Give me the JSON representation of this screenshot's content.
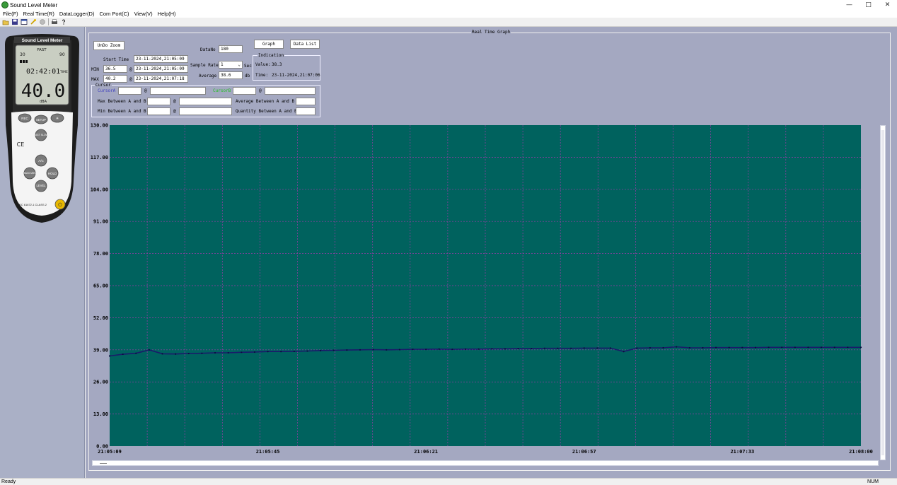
{
  "window": {
    "title": "Sound Level Meter",
    "minimize": "—",
    "maximize": "□",
    "close": "✕"
  },
  "menu": [
    "File(F)",
    "Real Time(R)",
    "DataLogger(D)",
    "Com Port(C)",
    "View(V)",
    "Help(H)"
  ],
  "toolbar": {
    "icons": [
      "open-icon",
      "save-icon",
      "window-icon",
      "connect-icon",
      "disconnect-icon",
      "print-icon",
      "help-icon"
    ]
  },
  "device": {
    "brand_label": "Sound Level Meter",
    "lcd_mode": "FAST",
    "lcd_range_low": "30",
    "lcd_range_high": "90",
    "lcd_time": "02:42:01",
    "lcd_time_label": "TIME",
    "lcd_value": "40.0",
    "lcd_unit": "dBA",
    "btn_rec": "REC",
    "btn_setup": "SETUP",
    "btn_light": "☀",
    "btn_fast_slow": "FAST SLOW",
    "btn_ac": "A/C",
    "btn_maxmin": "MAX MIN",
    "btn_hold": "HOLD",
    "btn_level": "LEVEL",
    "ce_mark": "CE",
    "standard": "IEC 61672-1 CLASS 2",
    "power": "⏻"
  },
  "controls": {
    "frame_title": "Real Time Graph",
    "undo_zoom": "UnDo Zoom",
    "start_time_label": "Start Time",
    "start_time": "23-11-2024,21:05:09",
    "min_label": "MIN",
    "min_value": "36.5",
    "min_at": "@",
    "min_time": "23-11-2024,21:05:09",
    "max_label": "MAX",
    "max_value": "40.2",
    "max_at": "@",
    "max_time": "23-11-2024,21:07:18",
    "datano_label": "DataNo",
    "datano_value": "180",
    "sample_rate_label": "Sample Rate",
    "sample_rate_value": "1",
    "sample_rate_unit": "Sec",
    "average_label": "Average",
    "average_value": "38.6",
    "average_unit": "db",
    "graph_btn": "Graph",
    "data_list_btn": "Data List",
    "indication_title": "Indication",
    "indication_value_label": "Value:",
    "indication_value": "38.3",
    "indication_time_label": "Time:",
    "indication_time": "23-11-2024,21:07:06"
  },
  "cursor": {
    "title": "Cursor",
    "cursor_a_label": "CursorA",
    "cursor_b_label": "CursorB",
    "at": "@",
    "max_between": "Max Between A and B",
    "min_between": "Min Between A and B",
    "avg_between": "Average Between A and B",
    "qty_between": "Quantity Between A and B",
    "cursor_a_color": "#4040c0",
    "cursor_b_color": "#20c020"
  },
  "status": {
    "left": "Ready",
    "right": "NUM"
  },
  "colors": {
    "plot_bg": "#00625e",
    "grid": "#9a3aa8",
    "line": "#1a1a6a",
    "panel": "#a4a8c1"
  },
  "chart_data": {
    "type": "line",
    "title": "",
    "xlabel": "",
    "ylabel": "",
    "ylim": [
      0,
      130
    ],
    "yticks": [
      "0.00",
      "13.00",
      "26.00",
      "39.00",
      "52.00",
      "65.00",
      "78.00",
      "91.00",
      "104.00",
      "117.00",
      "130.00"
    ],
    "xticks": [
      "21:05:09",
      "21:05:45",
      "21:06:21",
      "21:06:57",
      "21:07:33",
      "21:08:00"
    ],
    "grid": true,
    "series": [
      {
        "x": [
          "21:05:09",
          "21:05:12",
          "21:05:15",
          "21:05:18",
          "21:05:21",
          "21:05:24",
          "21:05:27",
          "21:05:30",
          "21:05:33",
          "21:05:36",
          "21:05:39",
          "21:05:42",
          "21:05:45",
          "21:05:48",
          "21:05:51",
          "21:05:54",
          "21:05:57",
          "21:06:00",
          "21:06:03",
          "21:06:06",
          "21:06:09",
          "21:06:12",
          "21:06:15",
          "21:06:18",
          "21:06:21",
          "21:06:24",
          "21:06:27",
          "21:06:30",
          "21:06:33",
          "21:06:36",
          "21:06:39",
          "21:06:42",
          "21:06:45",
          "21:06:48",
          "21:06:51",
          "21:06:54",
          "21:06:57",
          "21:07:00",
          "21:07:03",
          "21:07:06",
          "21:07:09",
          "21:07:12",
          "21:07:15",
          "21:07:18",
          "21:07:21",
          "21:07:24",
          "21:07:27",
          "21:07:30",
          "21:07:33",
          "21:07:36",
          "21:07:39",
          "21:07:42",
          "21:07:45",
          "21:07:48",
          "21:07:51",
          "21:07:54",
          "21:07:57",
          "21:08:00"
        ],
        "values": [
          36.5,
          37.2,
          37.6,
          39.0,
          37.4,
          37.3,
          37.5,
          37.6,
          37.8,
          37.8,
          38.0,
          38.1,
          38.3,
          38.3,
          38.4,
          38.5,
          38.7,
          38.8,
          38.9,
          39.0,
          39.1,
          39.0,
          39.1,
          39.2,
          39.2,
          39.3,
          39.2,
          39.3,
          39.3,
          39.4,
          39.4,
          39.5,
          39.5,
          39.6,
          39.6,
          39.6,
          39.7,
          39.7,
          39.7,
          38.3,
          39.7,
          39.8,
          39.8,
          40.2,
          39.8,
          39.8,
          39.9,
          39.9,
          39.9,
          39.9,
          40.0,
          40.0,
          40.0,
          40.0,
          40.0,
          40.0,
          40.0,
          40.0
        ]
      }
    ]
  }
}
